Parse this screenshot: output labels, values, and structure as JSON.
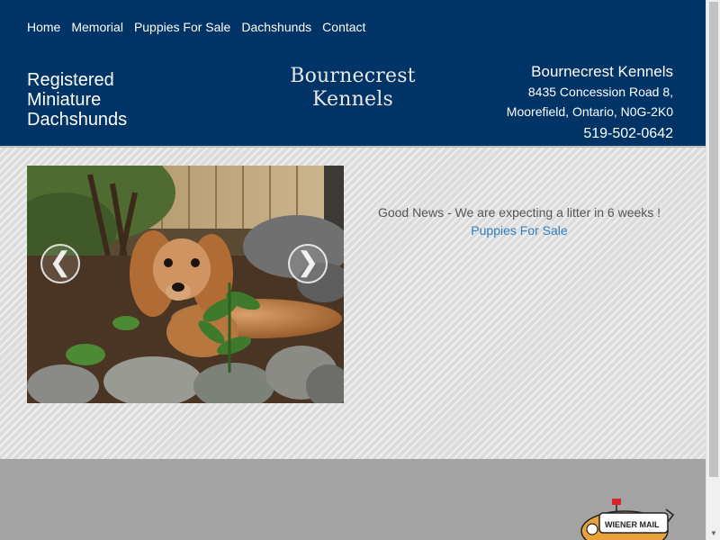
{
  "nav": {
    "items": [
      {
        "label": "Home"
      },
      {
        "label": "Memorial"
      },
      {
        "label": "Puppies For Sale"
      },
      {
        "label": "Dachshunds"
      },
      {
        "label": "Contact"
      }
    ]
  },
  "header": {
    "tagline_line1": "Registered",
    "tagline_line2": "Miniature",
    "tagline_line3": "Dachshunds",
    "brand_line1": "Bournecrest",
    "brand_line2": "Kennels",
    "contact_name": "Bournecrest Kennels",
    "contact_street": "8435 Concession Road 8,",
    "contact_city": "Moorefield, Ontario, N0G-2K0",
    "contact_phone": "519-502-0642"
  },
  "slider": {
    "prev_glyph": "❮",
    "next_glyph": "❯"
  },
  "news": {
    "message": "Good News - We are expecting a litter in 6 weeks !",
    "link_label": "Puppies For Sale"
  },
  "footer": {
    "mailbox_label": "WIENER MAIL"
  },
  "colors": {
    "header_bg": "#003366",
    "footer_bg": "#a3a3a3",
    "link": "#2f7fc1"
  }
}
